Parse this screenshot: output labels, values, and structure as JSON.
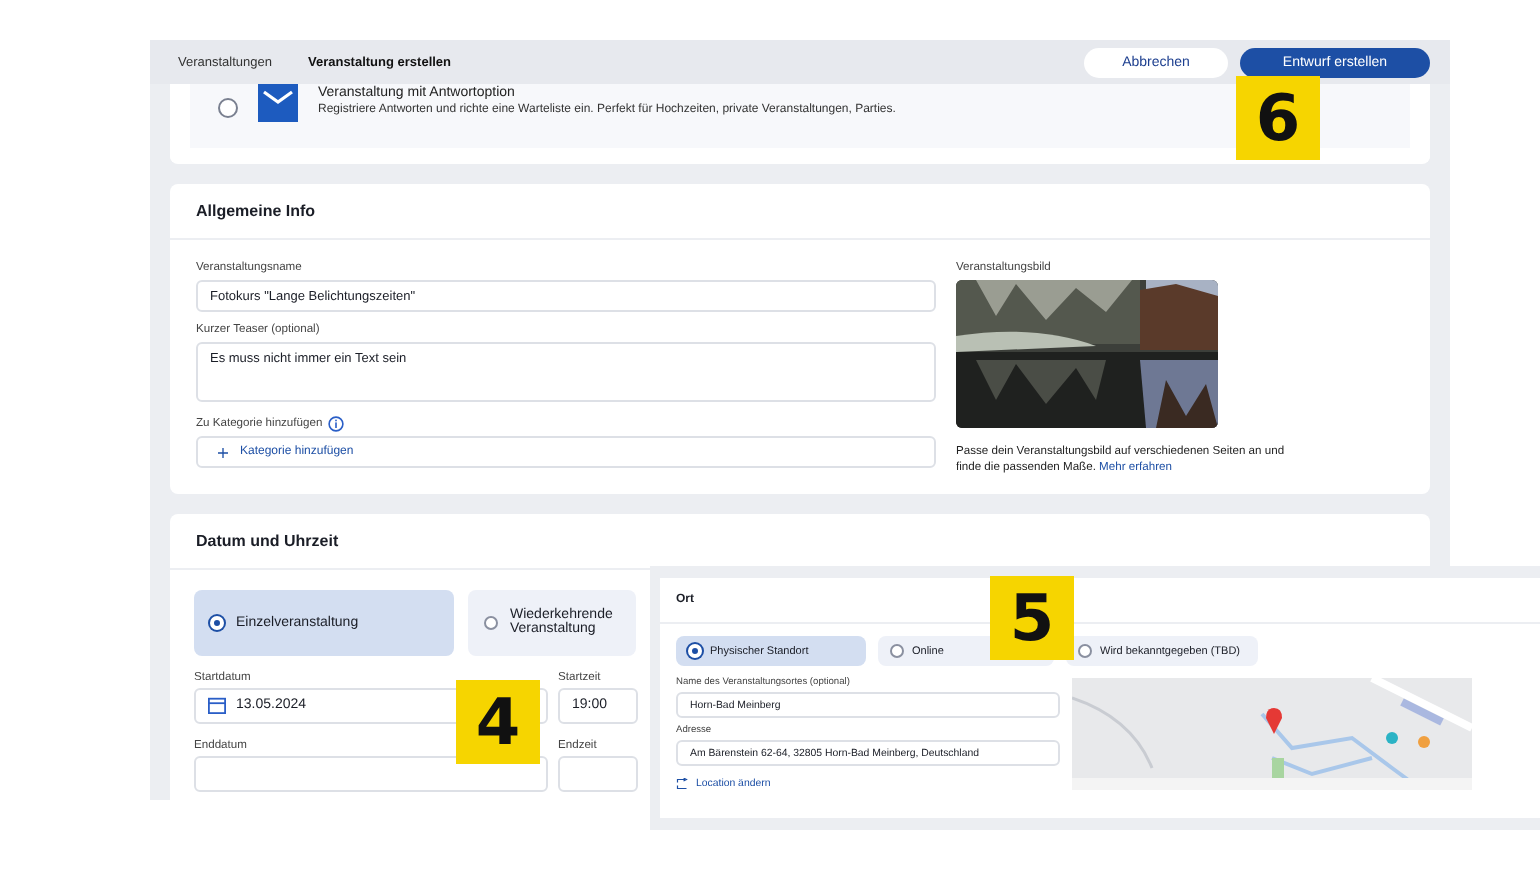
{
  "breadcrumb": [
    "Veranstaltungen",
    "Veranstaltung erstellen"
  ],
  "buttons": {
    "cancel": "Abbrechen",
    "create": "Entwurf erstellen"
  },
  "rsvp_option": {
    "title": "Veranstaltung mit Antwortoption",
    "description": "Registriere Antworten und richte eine Warteliste ein. Perfekt für Hochzeiten, private Veranstaltungen, Parties.",
    "selected": false
  },
  "general": {
    "title": "Allgemeine Info",
    "name_label": "Veranstaltungsname",
    "name_value": "Fotokurs \"Lange Belichtungszeiten\"",
    "teaser_label": "Kurzer Teaser (optional)",
    "teaser_value": "Es muss nicht immer ein Text sein",
    "category_label": "Zu Kategorie hinzufügen",
    "category_button": "Kategorie hinzufügen",
    "image_label": "Veranstaltungsbild",
    "image_hint": "Passe dein Veranstaltungsbild auf verschiedenen Seiten an und finde die passenden Maße.",
    "image_link": "Mehr erfahren"
  },
  "date": {
    "title": "Datum und Uhrzeit",
    "options": [
      {
        "label": "Einzelveranstaltung",
        "selected": true
      },
      {
        "label": "Wiederkehrende Veranstaltung",
        "selected": false
      }
    ],
    "start_date_label": "Startdatum",
    "start_date": "13.05.2024",
    "start_time_label": "Startzeit",
    "start_time": "19:00",
    "end_date_label": "Enddatum",
    "end_time_label": "Endzeit"
  },
  "location": {
    "title": "Ort",
    "options": [
      {
        "label": "Physischer Standort",
        "selected": true
      },
      {
        "label": "Online",
        "selected": false
      },
      {
        "label": "Wird bekanntgegeben (TBD)",
        "selected": false
      }
    ],
    "venue_label": "Name des Veranstaltungsortes (optional)",
    "venue_value": "Horn-Bad Meinberg",
    "address_label": "Adresse",
    "address_value": "Am Bärenstein 62-64, 32805 Horn-Bad Meinberg, Deutschland",
    "change_link": "Location ändern"
  },
  "badges": [
    "6",
    "4",
    "5"
  ]
}
